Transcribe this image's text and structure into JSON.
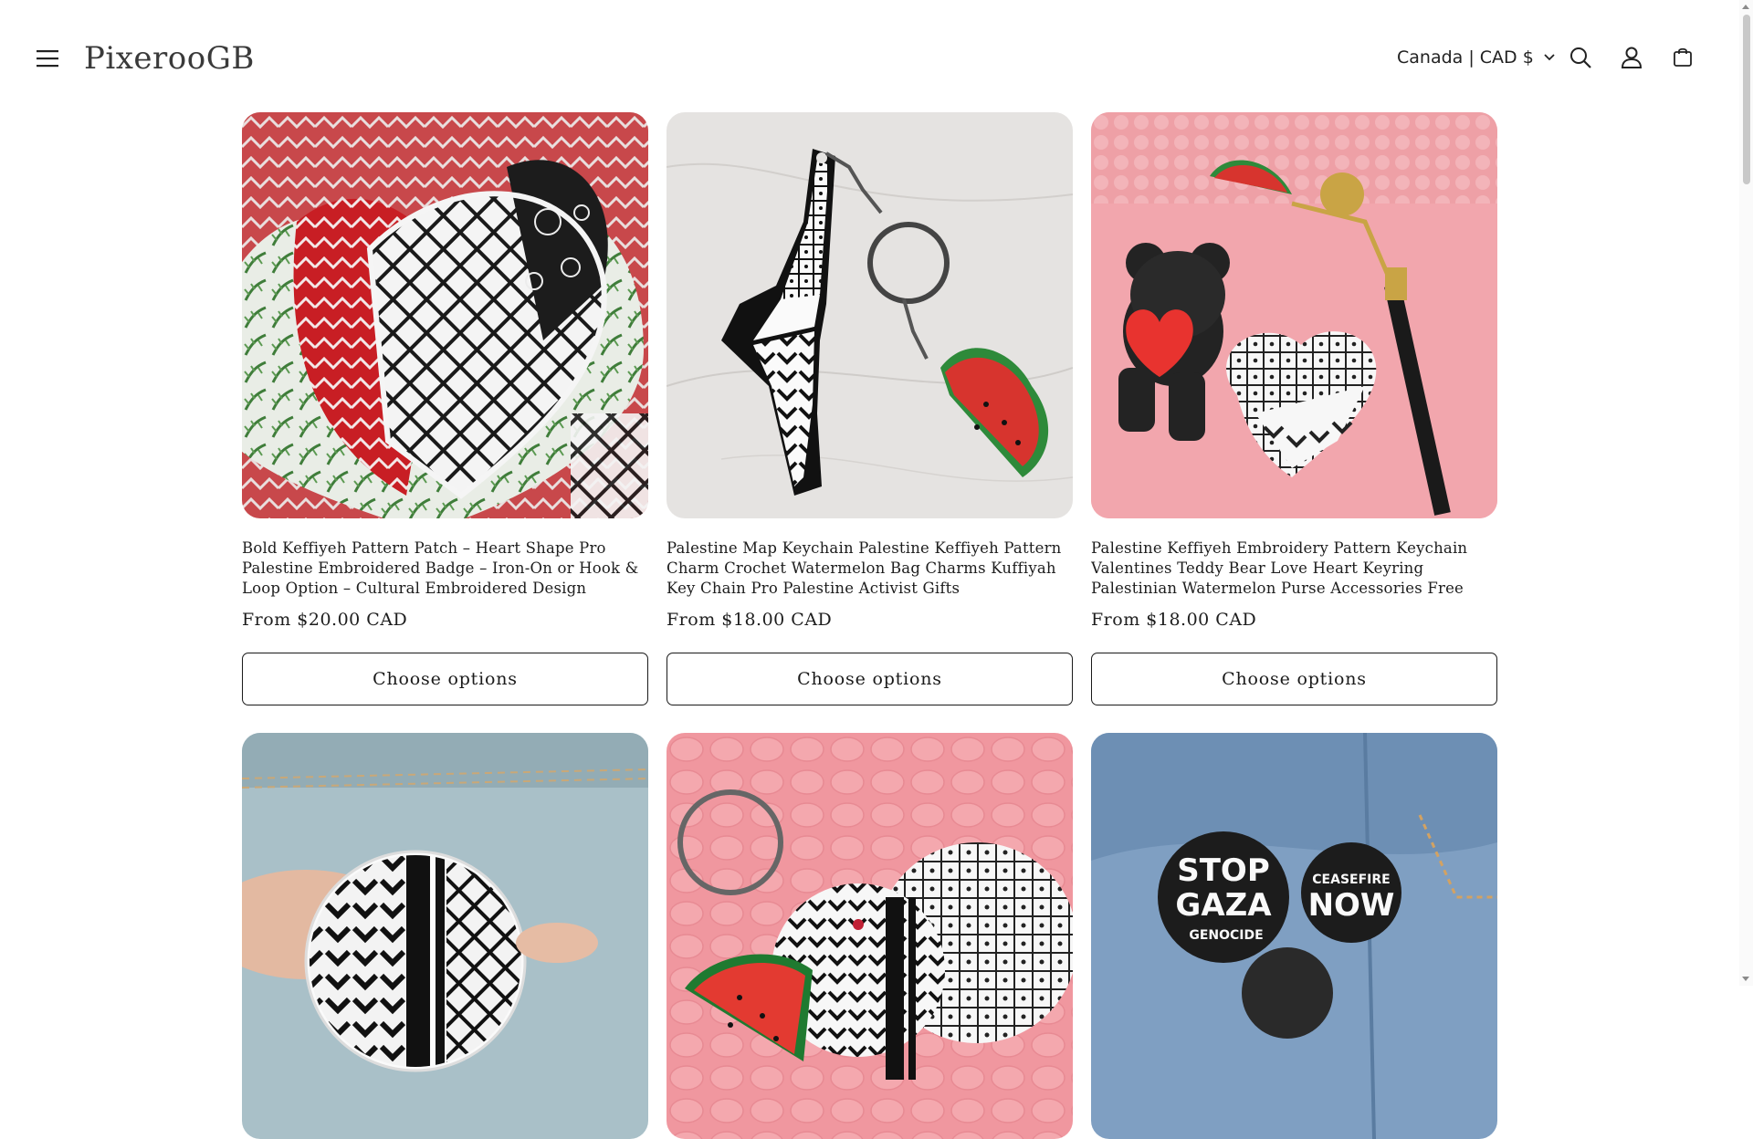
{
  "header": {
    "logo": "PixerooGB",
    "country_selector": "Canada | CAD $",
    "icons": [
      "menu-icon",
      "search-icon",
      "account-icon",
      "cart-icon"
    ]
  },
  "products": [
    {
      "title": "Bold Keffiyeh Pattern Patch – Heart Shape Pro Palestine Embroidered Badge – Iron-On or Hook & Loop Option – Cultural Embroidered Design",
      "price": "From $20.00 CAD",
      "button": "Choose options"
    },
    {
      "title": "Palestine Map Keychain Palestine Keffiyeh Pattern Charm Crochet Watermelon Bag Charms Kuffiyah Key Chain Pro Palestine Activist Gifts",
      "price": "From $18.00 CAD",
      "button": "Choose options"
    },
    {
      "title": "Palestine Keffiyeh Embroidery Pattern Keychain Valentines Teddy Bear Love Heart Keyring Palestinian Watermelon Purse Accessories Free Gaza",
      "price": "From $18.00 CAD",
      "button": "Choose options"
    }
  ],
  "second_row_images": {
    "badge_left": "STOP",
    "badge_mid": "GAZA",
    "badge_bottom": "GENOCIDE",
    "badge2_top": "CEASEFIRE",
    "badge2_bottom": "NOW"
  },
  "colors": {
    "background": "#ffffff",
    "text": "#121212",
    "button_border": "#1a1a1a"
  }
}
